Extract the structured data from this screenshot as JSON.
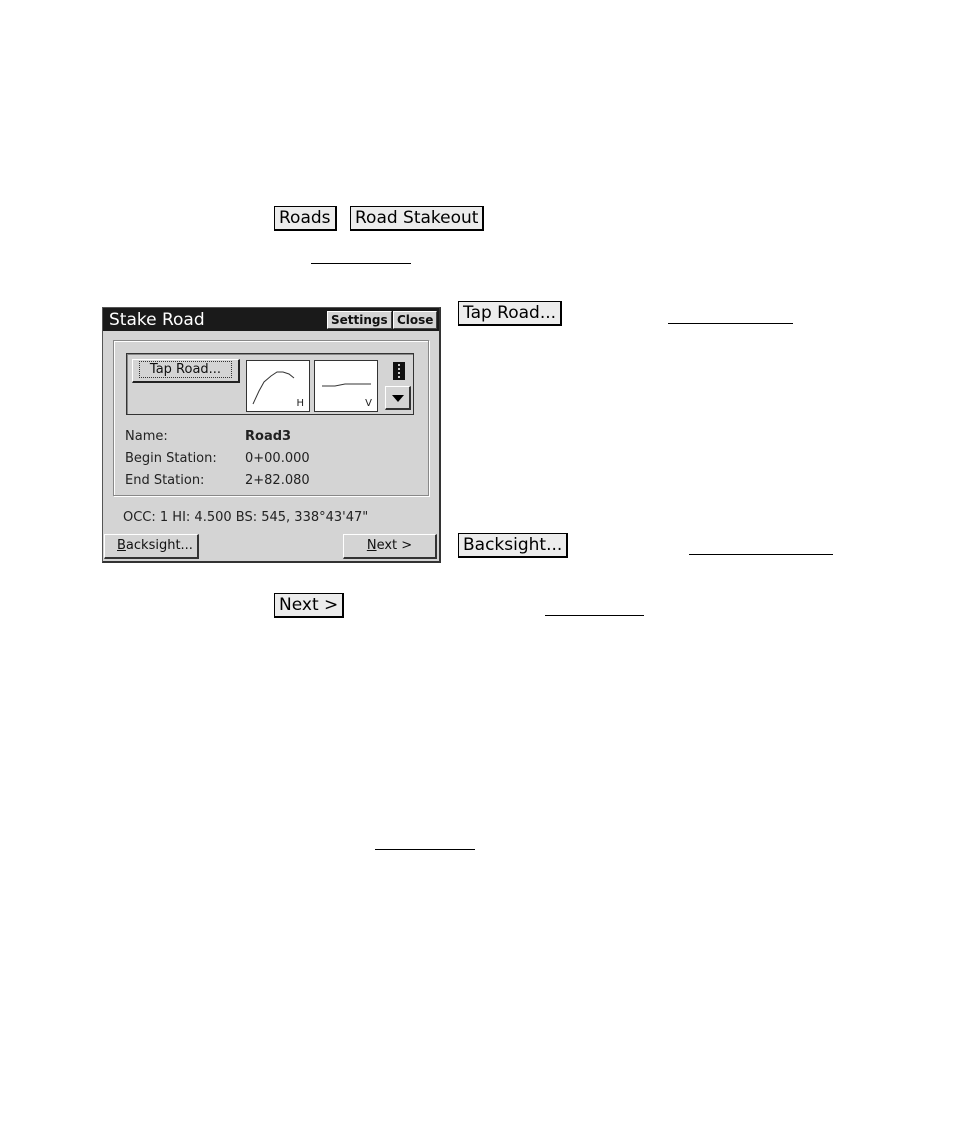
{
  "doc": {
    "inline_buttons": {
      "roads": "Roads",
      "road_stakeout": "Road Stakeout",
      "tap_road": "Tap Road...",
      "backsight": "Backsight...",
      "next": "Next >"
    }
  },
  "window": {
    "title": "Stake Road",
    "settings_label": "Settings",
    "close_label": "Close",
    "tap_road_label": "Tap Road...",
    "h_label": "H",
    "v_label": "V",
    "fields": [
      {
        "label": "Name:",
        "value": "Road3"
      },
      {
        "label": "Begin Station:",
        "value": "0+00.000"
      },
      {
        "label": "End Station:",
        "value": "2+82.080"
      }
    ],
    "status": "OCC: 1  HI: 4.500  BS: 545, 338°43'47\"",
    "backsight": {
      "accel": "B",
      "rest": "acksight..."
    },
    "next": {
      "accel": "N",
      "rest": "ext >"
    }
  }
}
